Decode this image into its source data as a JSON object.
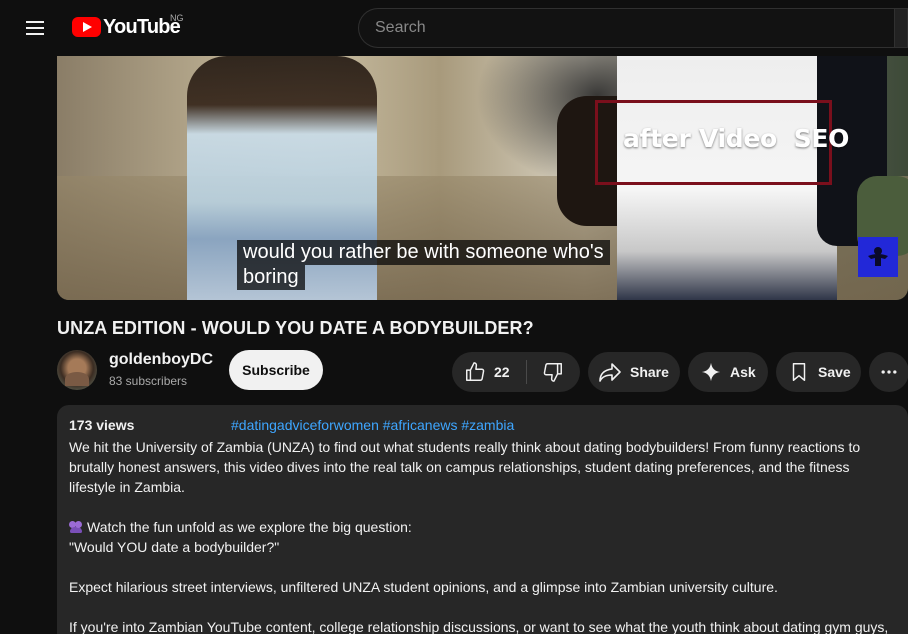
{
  "masthead": {
    "logo_text": "YouTube",
    "region": "NG",
    "search_placeholder": "Search"
  },
  "player": {
    "overlay_text": "after Video  SEO",
    "caption_line1": "would you rather be with someone who's",
    "caption_line2": "boring"
  },
  "video": {
    "title": "UNZA EDITION - WOULD YOU DATE A BODYBUILDER?"
  },
  "channel": {
    "name": "goldenboyDC",
    "subscribers": "83 subscribers",
    "subscribe_label": "Subscribe"
  },
  "actions": {
    "like_count": "22",
    "share_label": "Share",
    "ask_label": "Ask",
    "save_label": "Save"
  },
  "description": {
    "views": "173 views",
    "hashtags": [
      "#datingadviceforwomen",
      "#africanews",
      "#zambia"
    ],
    "para1": "We hit the University of Zambia (UNZA) to find out what students really think about dating bodybuilders! From funny reactions to brutally honest answers, this video dives into the real talk on campus relationships, student dating preferences, and the fitness lifestyle in Zambia.",
    "para2_line1": "Watch the fun unfold as we explore the big question:",
    "para2_line2": "\"Would YOU date a bodybuilder?\"",
    "para3": "Expect hilarious street interviews, unfiltered UNZA student opinions, and a glimpse into Zambian university culture.",
    "para4": "If you're into Zambian YouTube content, college relationship discussions, or want to see what the youth think about dating gym guys,"
  },
  "colors": {
    "background": "#0f0f0f",
    "surface": "#272727",
    "brand_red": "#ff0000",
    "link_blue": "#3ea6ff",
    "seo_box": "#7a0f1c"
  }
}
